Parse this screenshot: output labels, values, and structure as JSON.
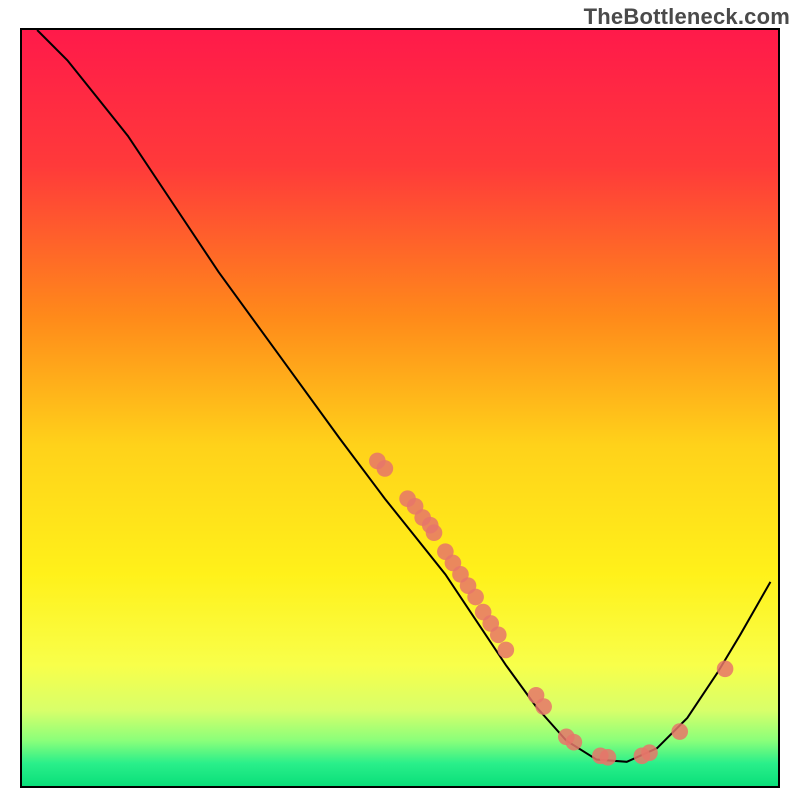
{
  "watermark": "TheBottleneck.com",
  "chart_data": {
    "type": "line",
    "title": "",
    "xlabel": "",
    "ylabel": "",
    "xlim": [
      0,
      100
    ],
    "ylim": [
      0,
      100
    ],
    "curve": [
      {
        "x": 2,
        "y": 100
      },
      {
        "x": 6,
        "y": 96
      },
      {
        "x": 10,
        "y": 91
      },
      {
        "x": 14,
        "y": 86
      },
      {
        "x": 20,
        "y": 77
      },
      {
        "x": 26,
        "y": 68
      },
      {
        "x": 34,
        "y": 57
      },
      {
        "x": 42,
        "y": 46
      },
      {
        "x": 48,
        "y": 38
      },
      {
        "x": 52,
        "y": 33
      },
      {
        "x": 56,
        "y": 28
      },
      {
        "x": 60,
        "y": 22
      },
      {
        "x": 64,
        "y": 16
      },
      {
        "x": 68,
        "y": 10.5
      },
      {
        "x": 72,
        "y": 6
      },
      {
        "x": 76,
        "y": 3.5
      },
      {
        "x": 80,
        "y": 3.2
      },
      {
        "x": 84,
        "y": 5
      },
      {
        "x": 88,
        "y": 9
      },
      {
        "x": 92,
        "y": 15
      },
      {
        "x": 95,
        "y": 20
      },
      {
        "x": 97,
        "y": 23.5
      },
      {
        "x": 99,
        "y": 27
      }
    ],
    "scatter": [
      {
        "x": 47,
        "y": 43
      },
      {
        "x": 48,
        "y": 42
      },
      {
        "x": 51,
        "y": 38
      },
      {
        "x": 52,
        "y": 37
      },
      {
        "x": 53,
        "y": 35.5
      },
      {
        "x": 54,
        "y": 34.5
      },
      {
        "x": 54.5,
        "y": 33.5
      },
      {
        "x": 56,
        "y": 31
      },
      {
        "x": 57,
        "y": 29.5
      },
      {
        "x": 58,
        "y": 28
      },
      {
        "x": 59,
        "y": 26.5
      },
      {
        "x": 60,
        "y": 25
      },
      {
        "x": 61,
        "y": 23
      },
      {
        "x": 62,
        "y": 21.5
      },
      {
        "x": 63,
        "y": 20
      },
      {
        "x": 64,
        "y": 18
      },
      {
        "x": 68,
        "y": 12
      },
      {
        "x": 69,
        "y": 10.5
      },
      {
        "x": 72,
        "y": 6.5
      },
      {
        "x": 73,
        "y": 5.8
      },
      {
        "x": 76.5,
        "y": 4
      },
      {
        "x": 77.5,
        "y": 3.8
      },
      {
        "x": 82,
        "y": 4
      },
      {
        "x": 83,
        "y": 4.4
      },
      {
        "x": 87,
        "y": 7.2
      },
      {
        "x": 93,
        "y": 15.5
      }
    ],
    "gradient_stops": [
      {
        "y": 0,
        "color": "#ff1a4a"
      },
      {
        "y": 18,
        "color": "#ff3a3a"
      },
      {
        "y": 38,
        "color": "#ff8a1a"
      },
      {
        "y": 55,
        "color": "#ffd21a"
      },
      {
        "y": 72,
        "color": "#fff11a"
      },
      {
        "y": 84,
        "color": "#f8ff4a"
      },
      {
        "y": 90,
        "color": "#d8ff6a"
      },
      {
        "y": 94,
        "color": "#8aff7a"
      },
      {
        "y": 97,
        "color": "#2aef8a"
      },
      {
        "y": 100,
        "color": "#0adf7a"
      }
    ],
    "curve_color": "#000000",
    "point_color": "#e6766a",
    "point_radius": 1.1
  }
}
